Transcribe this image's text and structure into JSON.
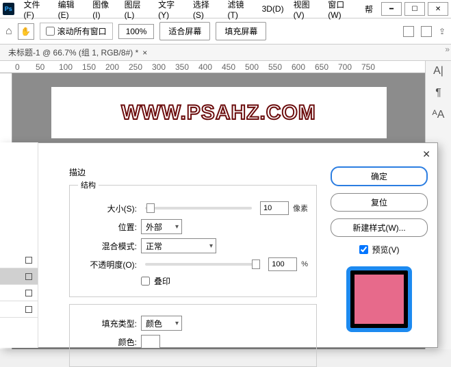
{
  "menu": {
    "file": "文件(F)",
    "edit": "编辑(E)",
    "image": "图像(I)",
    "layer": "图层(L)",
    "type": "文字(Y)",
    "select": "选择(S)",
    "filter": "滤镜(T)",
    "threeD": "3D(D)",
    "view": "视图(V)",
    "window": "窗口(W)",
    "help": "帮"
  },
  "window_controls": {
    "min": "━",
    "max": "☐",
    "close": "✕"
  },
  "options": {
    "scroll_all": "滚动所有窗口",
    "zoom": "100%",
    "fit_screen": "适合屏幕",
    "fill_screen": "填充屏幕"
  },
  "doc_tab": {
    "title": "未标题-1 @ 66.7% (组 1, RGB/8#) *",
    "close": "×"
  },
  "ruler": {
    "t0": "0",
    "t50": "50",
    "t100": "100",
    "t150": "150",
    "t200": "200",
    "t250": "250",
    "t300": "300",
    "t350": "350",
    "t400": "400",
    "t450": "450",
    "t500": "500",
    "t550": "550",
    "t600": "600",
    "t650": "650",
    "t700": "700",
    "t750": "750"
  },
  "canvas": {
    "text": "WWW.PSAHZ.COM"
  },
  "dialog": {
    "title": "描边",
    "section_structure": "结构",
    "size_label": "大小(S):",
    "size_value": "10",
    "size_unit": "像素",
    "position_label": "位置:",
    "position_value": "外部",
    "blend_label": "混合模式:",
    "blend_value": "正常",
    "opacity_label": "不透明度(O):",
    "opacity_value": "100",
    "opacity_unit": "%",
    "overprint": "叠印",
    "fill_type_label": "填充类型:",
    "fill_type_value": "颜色",
    "color_label": "颜色:",
    "ok": "确定",
    "reset": "复位",
    "new_style": "新建样式(W)...",
    "preview": "预览(V)"
  },
  "icons": {
    "ps": "Ps",
    "home": "⌂",
    "hand": "✋",
    "share": "⇪",
    "char_A": "A|",
    "para": "¶",
    "charA2": "ᴬA",
    "arrow": "»"
  }
}
